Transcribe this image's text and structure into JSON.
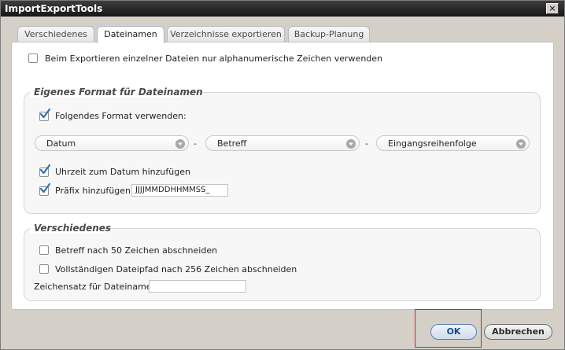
{
  "window": {
    "title": "ImportExportTools",
    "close_glyph": "×"
  },
  "tabs": [
    {
      "label": "Verschiedenes",
      "active": false
    },
    {
      "label": "Dateinamen",
      "active": true
    },
    {
      "label": "Verzeichnisse exportieren",
      "active": false
    },
    {
      "label": "Backup-Planung",
      "active": false
    }
  ],
  "top_option": {
    "label": "Beim Exportieren einzelner Dateien nur alphanumerische Zeichen verwenden",
    "checked": false
  },
  "format_group": {
    "title": "Eigenes Format für Dateinamen",
    "use_format": {
      "label": "Folgendes Format verwenden:",
      "checked": true
    },
    "selects": [
      {
        "value": "Datum"
      },
      {
        "value": "Betreff"
      },
      {
        "value": "Eingangsreihenfolge"
      }
    ],
    "separator": "-",
    "add_time": {
      "label": "Uhrzeit zum Datum hinzufügen",
      "checked": true
    },
    "add_prefix": {
      "label": "Präfix hinzufügen",
      "checked": true,
      "value": "JJJJMMDDHHMMSS_"
    }
  },
  "misc_group": {
    "title": "Verschiedenes",
    "truncate_subject": {
      "label": "Betreff nach 50 Zeichen abschneiden",
      "checked": false
    },
    "truncate_path": {
      "label": "Vollständigen Dateipfad nach 256 Zeichen abschneiden",
      "checked": false
    },
    "charset": {
      "label": "Zeichensatz für Dateinamen:",
      "value": ""
    }
  },
  "buttons": {
    "ok": "OK",
    "cancel": "Abbrechen"
  },
  "colors": {
    "titlebar": "#1e1e1e",
    "check": "#2f6fb5",
    "ok_text": "#1b4a86",
    "focus_ring": "#d42020"
  }
}
